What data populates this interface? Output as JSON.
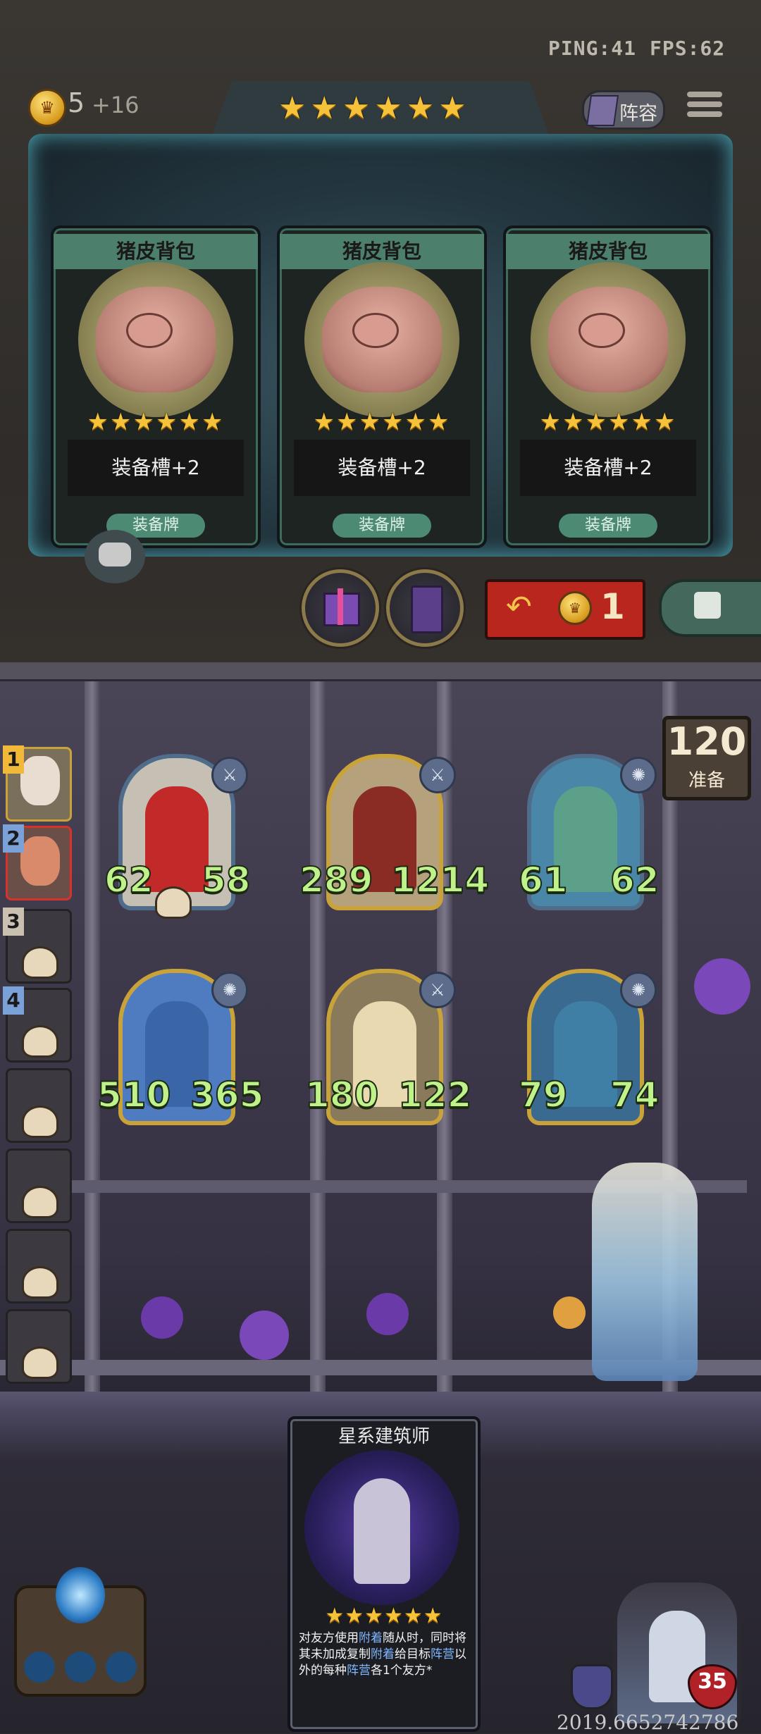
{
  "hud": {
    "ping": "PING:41",
    "fps": "FPS:62",
    "gold": "5",
    "gold_income": "+16",
    "shop_stars": "★★★★★★",
    "lineup_label": "阵容"
  },
  "shop": {
    "cards": [
      {
        "name": "猪皮背包",
        "stars": "★★★★★★",
        "effect": "装备槽+2",
        "type": "装备牌"
      },
      {
        "name": "猪皮背包",
        "stars": "★★★★★★",
        "effect": "装备槽+2",
        "type": "装备牌"
      },
      {
        "name": "猪皮背包",
        "stars": "★★★★★★",
        "effect": "装备槽+2",
        "type": "装备牌"
      }
    ],
    "refresh_cost": "1"
  },
  "board": {
    "timer": "120",
    "timer_label": "准备",
    "units": [
      {
        "attack": "62",
        "health": "58"
      },
      {
        "attack": "289",
        "health": "1214"
      },
      {
        "attack": "61",
        "health": "62"
      },
      {
        "attack": "510",
        "health": "365"
      },
      {
        "attack": "180",
        "health": "122"
      },
      {
        "attack": "79",
        "health": "74"
      }
    ]
  },
  "players": {
    "ranks": [
      "1",
      "2",
      "3",
      "4"
    ]
  },
  "hand": {
    "card_name": "星系建筑师",
    "stars": "★★★★★★",
    "desc_1": "对友方使用",
    "desc_kw1": "附着",
    "desc_2": "随从时，同时将其未加成复制",
    "desc_kw2": "附着",
    "desc_3": "给目标",
    "desc_kw3": "阵营",
    "desc_4": "以外的每种",
    "desc_kw4": "阵营",
    "desc_5": "各1个友方*"
  },
  "hero": {
    "health": "35"
  },
  "footer": {
    "version": "2019.6652742786"
  },
  "colors": {
    "gold": "#f6c23a",
    "stat_green": "#bff28a",
    "refresh_red": "#b8261e",
    "keyword_blue": "#7fb7ff"
  }
}
